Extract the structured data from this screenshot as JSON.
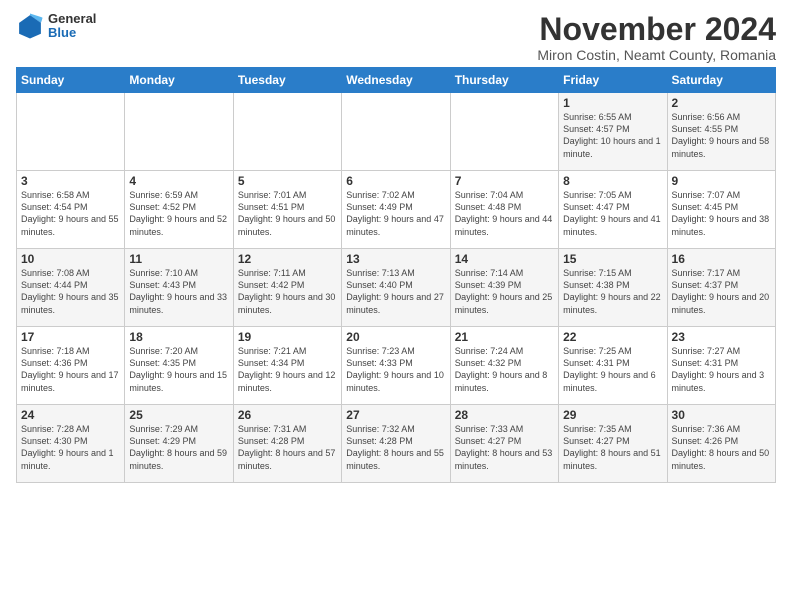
{
  "logo": {
    "general": "General",
    "blue": "Blue"
  },
  "header": {
    "month_title": "November 2024",
    "location": "Miron Costin, Neamt County, Romania"
  },
  "columns": [
    "Sunday",
    "Monday",
    "Tuesday",
    "Wednesday",
    "Thursday",
    "Friday",
    "Saturday"
  ],
  "weeks": [
    [
      {
        "day": "",
        "info": ""
      },
      {
        "day": "",
        "info": ""
      },
      {
        "day": "",
        "info": ""
      },
      {
        "day": "",
        "info": ""
      },
      {
        "day": "",
        "info": ""
      },
      {
        "day": "1",
        "info": "Sunrise: 6:55 AM\nSunset: 4:57 PM\nDaylight: 10 hours and 1 minute."
      },
      {
        "day": "2",
        "info": "Sunrise: 6:56 AM\nSunset: 4:55 PM\nDaylight: 9 hours and 58 minutes."
      }
    ],
    [
      {
        "day": "3",
        "info": "Sunrise: 6:58 AM\nSunset: 4:54 PM\nDaylight: 9 hours and 55 minutes."
      },
      {
        "day": "4",
        "info": "Sunrise: 6:59 AM\nSunset: 4:52 PM\nDaylight: 9 hours and 52 minutes."
      },
      {
        "day": "5",
        "info": "Sunrise: 7:01 AM\nSunset: 4:51 PM\nDaylight: 9 hours and 50 minutes."
      },
      {
        "day": "6",
        "info": "Sunrise: 7:02 AM\nSunset: 4:49 PM\nDaylight: 9 hours and 47 minutes."
      },
      {
        "day": "7",
        "info": "Sunrise: 7:04 AM\nSunset: 4:48 PM\nDaylight: 9 hours and 44 minutes."
      },
      {
        "day": "8",
        "info": "Sunrise: 7:05 AM\nSunset: 4:47 PM\nDaylight: 9 hours and 41 minutes."
      },
      {
        "day": "9",
        "info": "Sunrise: 7:07 AM\nSunset: 4:45 PM\nDaylight: 9 hours and 38 minutes."
      }
    ],
    [
      {
        "day": "10",
        "info": "Sunrise: 7:08 AM\nSunset: 4:44 PM\nDaylight: 9 hours and 35 minutes."
      },
      {
        "day": "11",
        "info": "Sunrise: 7:10 AM\nSunset: 4:43 PM\nDaylight: 9 hours and 33 minutes."
      },
      {
        "day": "12",
        "info": "Sunrise: 7:11 AM\nSunset: 4:42 PM\nDaylight: 9 hours and 30 minutes."
      },
      {
        "day": "13",
        "info": "Sunrise: 7:13 AM\nSunset: 4:40 PM\nDaylight: 9 hours and 27 minutes."
      },
      {
        "day": "14",
        "info": "Sunrise: 7:14 AM\nSunset: 4:39 PM\nDaylight: 9 hours and 25 minutes."
      },
      {
        "day": "15",
        "info": "Sunrise: 7:15 AM\nSunset: 4:38 PM\nDaylight: 9 hours and 22 minutes."
      },
      {
        "day": "16",
        "info": "Sunrise: 7:17 AM\nSunset: 4:37 PM\nDaylight: 9 hours and 20 minutes."
      }
    ],
    [
      {
        "day": "17",
        "info": "Sunrise: 7:18 AM\nSunset: 4:36 PM\nDaylight: 9 hours and 17 minutes."
      },
      {
        "day": "18",
        "info": "Sunrise: 7:20 AM\nSunset: 4:35 PM\nDaylight: 9 hours and 15 minutes."
      },
      {
        "day": "19",
        "info": "Sunrise: 7:21 AM\nSunset: 4:34 PM\nDaylight: 9 hours and 12 minutes."
      },
      {
        "day": "20",
        "info": "Sunrise: 7:23 AM\nSunset: 4:33 PM\nDaylight: 9 hours and 10 minutes."
      },
      {
        "day": "21",
        "info": "Sunrise: 7:24 AM\nSunset: 4:32 PM\nDaylight: 9 hours and 8 minutes."
      },
      {
        "day": "22",
        "info": "Sunrise: 7:25 AM\nSunset: 4:31 PM\nDaylight: 9 hours and 6 minutes."
      },
      {
        "day": "23",
        "info": "Sunrise: 7:27 AM\nSunset: 4:31 PM\nDaylight: 9 hours and 3 minutes."
      }
    ],
    [
      {
        "day": "24",
        "info": "Sunrise: 7:28 AM\nSunset: 4:30 PM\nDaylight: 9 hours and 1 minute."
      },
      {
        "day": "25",
        "info": "Sunrise: 7:29 AM\nSunset: 4:29 PM\nDaylight: 8 hours and 59 minutes."
      },
      {
        "day": "26",
        "info": "Sunrise: 7:31 AM\nSunset: 4:28 PM\nDaylight: 8 hours and 57 minutes."
      },
      {
        "day": "27",
        "info": "Sunrise: 7:32 AM\nSunset: 4:28 PM\nDaylight: 8 hours and 55 minutes."
      },
      {
        "day": "28",
        "info": "Sunrise: 7:33 AM\nSunset: 4:27 PM\nDaylight: 8 hours and 53 minutes."
      },
      {
        "day": "29",
        "info": "Sunrise: 7:35 AM\nSunset: 4:27 PM\nDaylight: 8 hours and 51 minutes."
      },
      {
        "day": "30",
        "info": "Sunrise: 7:36 AM\nSunset: 4:26 PM\nDaylight: 8 hours and 50 minutes."
      }
    ]
  ]
}
